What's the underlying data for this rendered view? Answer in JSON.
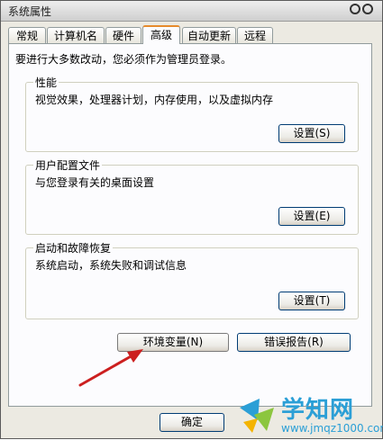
{
  "window": {
    "title": "系统属性"
  },
  "tabs": [
    {
      "label": "常规",
      "active": false
    },
    {
      "label": "计算机名",
      "active": false
    },
    {
      "label": "硬件",
      "active": false
    },
    {
      "label": "高级",
      "active": true
    },
    {
      "label": "自动更新",
      "active": false
    },
    {
      "label": "远程",
      "active": false
    }
  ],
  "notice": "要进行大多数改动，您必须作为管理员登录。",
  "groups": {
    "performance": {
      "title": "性能",
      "desc": "视觉效果，处理器计划，内存使用，以及虚拟内存",
      "button": "设置(S)"
    },
    "profiles": {
      "title": "用户配置文件",
      "desc": "与您登录有关的桌面设置",
      "button": "设置(E)"
    },
    "startup": {
      "title": "启动和故障恢复",
      "desc": "系统启动，系统失败和调试信息",
      "button": "设置(T)"
    }
  },
  "buttons": {
    "env_vars": "环境变量(N)",
    "error_report": "错误报告(R)",
    "ok": "确定"
  },
  "watermark": {
    "title": "学知网",
    "url": "www.jmqz1000.com"
  },
  "colors": {
    "arrow": "#cc1f1f",
    "active_tab_accent": "#e68b2c",
    "watermark": "#2b9fd6"
  }
}
